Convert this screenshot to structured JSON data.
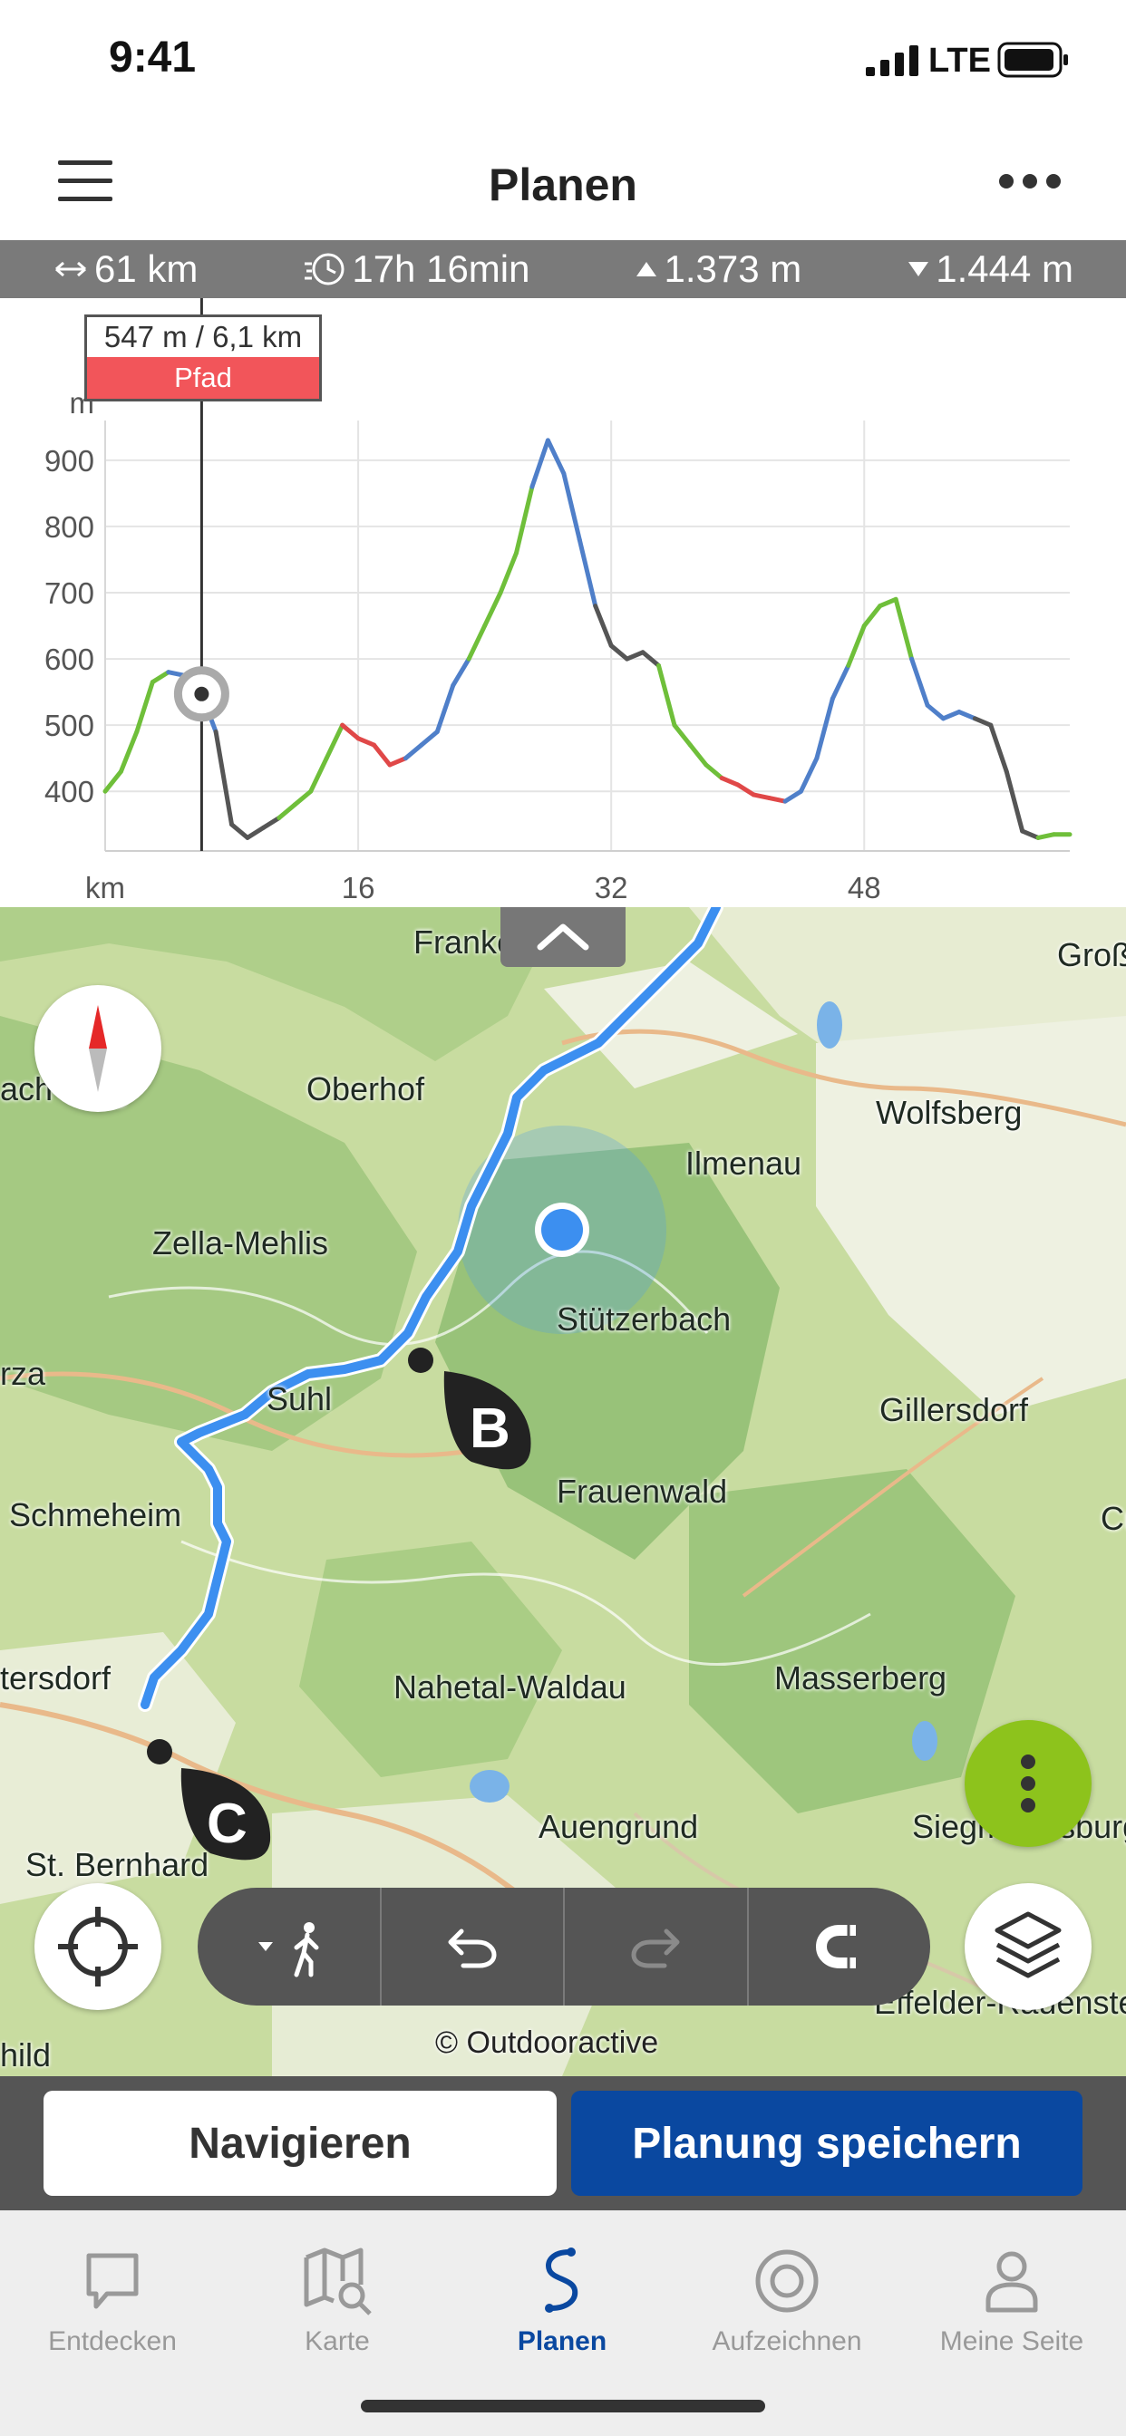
{
  "status_bar": {
    "time": "9:41",
    "network": "LTE"
  },
  "header": {
    "title": "Planen"
  },
  "stats": {
    "distance": "61 km",
    "duration": "17h 16min",
    "ascent": "1.373 m",
    "descent": "1.444 m"
  },
  "chart_data": {
    "type": "line",
    "y_unit_label": "m",
    "x_unit_label": "km",
    "yticks": [
      "900",
      "800",
      "700",
      "600",
      "500",
      "400"
    ],
    "xticks": [
      "16",
      "32",
      "48"
    ],
    "xlim": [
      0,
      61
    ],
    "ylim": [
      310,
      960
    ],
    "grid": true,
    "series": [
      {
        "x": [
          0,
          1,
          2,
          3,
          4,
          5,
          6,
          6.1,
          7,
          8,
          9,
          10,
          11,
          12,
          13,
          14,
          15,
          16,
          17,
          18,
          19,
          20,
          21,
          22,
          23,
          24,
          25,
          26,
          27,
          28,
          29,
          30,
          31,
          32,
          33,
          34,
          35,
          36,
          37,
          38,
          39,
          40,
          41,
          42,
          43,
          44,
          45,
          46,
          47,
          48,
          49,
          50,
          51,
          52,
          53,
          54,
          55,
          56,
          57,
          58,
          59,
          60,
          61
        ],
        "y": [
          400,
          430,
          490,
          565,
          580,
          575,
          585,
          547,
          490,
          350,
          330,
          345,
          360,
          380,
          400,
          450,
          500,
          480,
          470,
          440,
          450,
          470,
          490,
          560,
          600,
          650,
          700,
          760,
          860,
          930,
          880,
          780,
          680,
          620,
          600,
          610,
          590,
          500,
          470,
          440,
          420,
          410,
          395,
          390,
          385,
          400,
          450,
          540,
          590,
          650,
          680,
          690,
          600,
          530,
          510,
          520,
          510,
          500,
          430,
          340,
          330,
          335,
          335
        ]
      }
    ],
    "marker": {
      "x": 6.1,
      "y": 547
    }
  },
  "tooltip": {
    "value": "547 m / 6,1 km",
    "surface": "Pfad"
  },
  "map": {
    "places": {
      "franken": "Franken",
      "grossl": "Großl",
      "oberhof": "Oberhof",
      "achberg": "ach-berg",
      "wolfsberg": "Wolfsberg",
      "ilmenau": "Ilmenau",
      "zella_mehlis": "Zella-Mehlis",
      "stuetzerbach": "Stützerbach",
      "suhl": "Suhl",
      "gillersdorf": "Gillersdorf",
      "rza": "rza",
      "schmeheim": "Schmeheim",
      "frauenwald": "Frauenwald",
      "cu": "Cu",
      "tersdorf": "tersdorf",
      "nahetal": "Nahetal-Waldau",
      "masserberg": "Masserberg",
      "auengrund": "Auengrund",
      "siegmundsburg": "Siegmundsburg",
      "st_bernhard": "St. Bernhard",
      "effelder": "Effelder-Rauenstein",
      "hild": "hild"
    },
    "waypoints": {
      "b": "B",
      "c": "C"
    },
    "copyright": "© Outdooractive"
  },
  "actions": {
    "navigate": "Navigieren",
    "save": "Planung speichern"
  },
  "tabs": [
    {
      "label": "Entdecken"
    },
    {
      "label": "Karte"
    },
    {
      "label": "Planen"
    },
    {
      "label": "Aufzeichnen"
    },
    {
      "label": "Meine Seite"
    }
  ],
  "colors": {
    "accent_blue": "#0a48a0",
    "route_blue": "#3c8ff0",
    "fab_green": "#8dc31c",
    "tooltip_red": "#f2555a",
    "stats_gray": "#7a7a7a"
  }
}
